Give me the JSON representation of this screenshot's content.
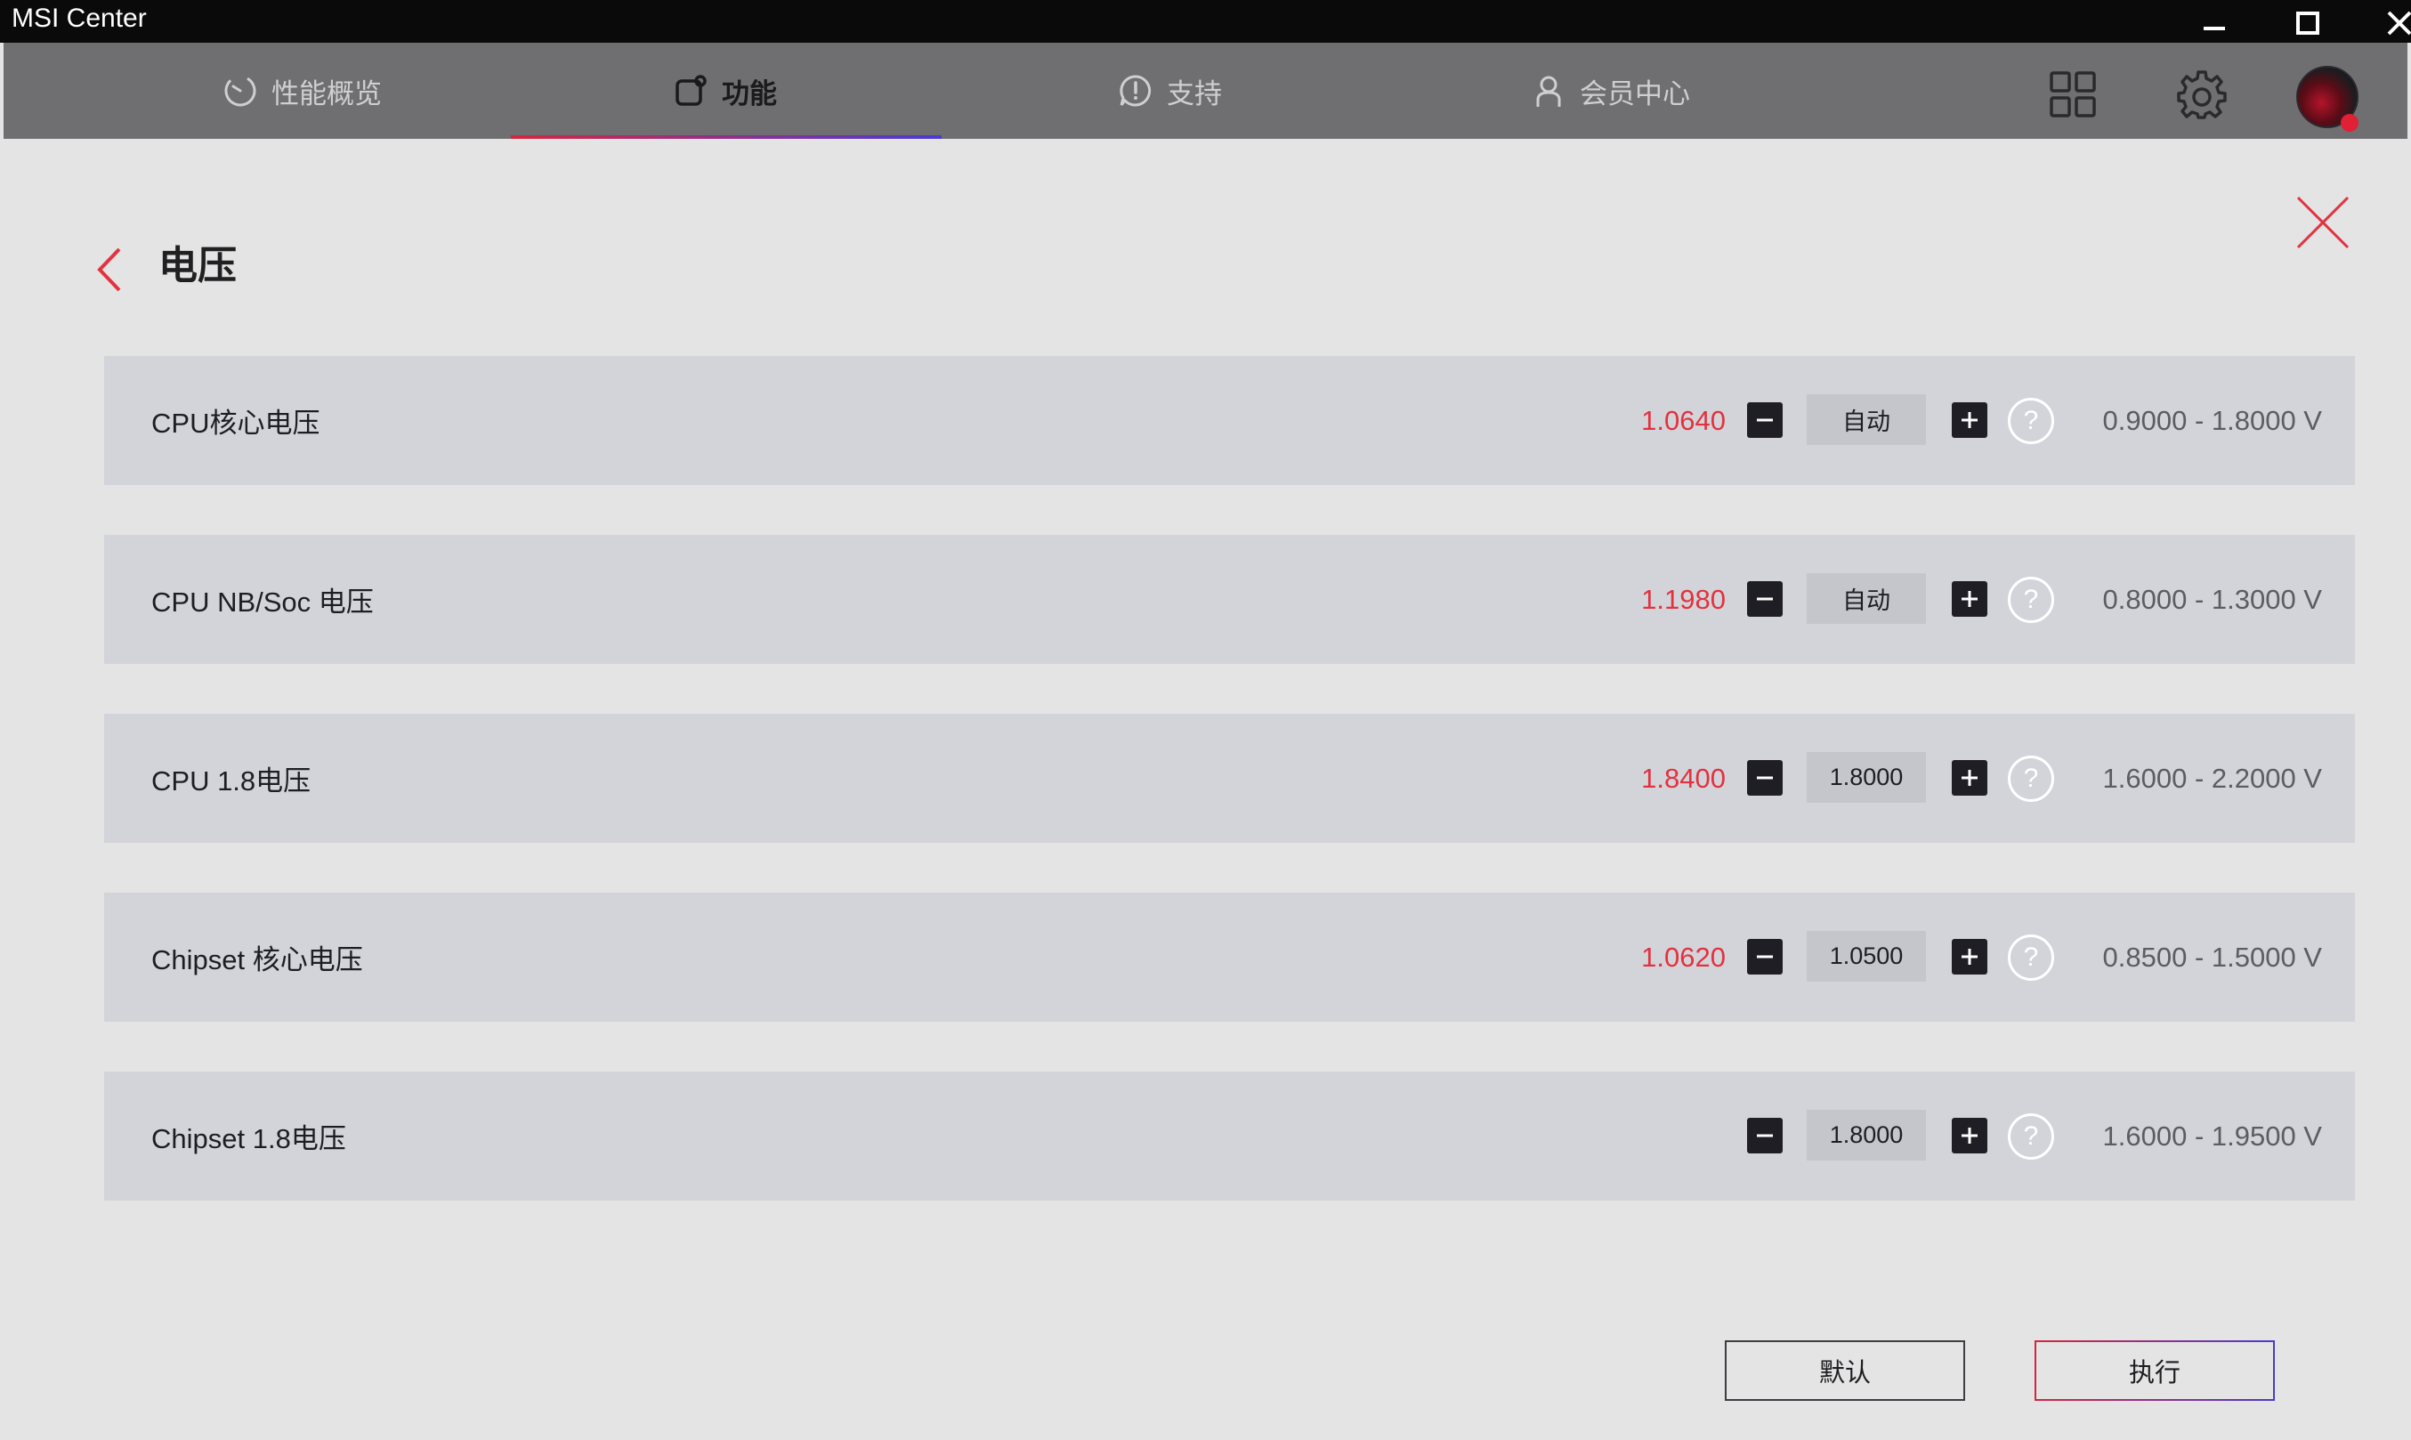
{
  "window": {
    "title": "MSI Center",
    "controls": {
      "minimize": "minimize-icon",
      "maximize": "maximize-icon",
      "close": "close-icon"
    }
  },
  "nav": {
    "tabs": [
      {
        "label": "性能概览",
        "icon": "performance-icon",
        "active": false
      },
      {
        "label": "功能",
        "icon": "features-icon",
        "active": true
      },
      {
        "label": "支持",
        "icon": "support-icon",
        "active": false
      },
      {
        "label": "会员中心",
        "icon": "member-icon",
        "active": false
      }
    ],
    "right_icons": [
      "apps-grid-icon",
      "gear-icon",
      "avatar"
    ]
  },
  "page": {
    "title": "电压",
    "back_icon": "chevron-left-icon",
    "close_icon": "close-x-icon"
  },
  "rows": [
    {
      "label": "CPU核心电压",
      "current": "1.0640",
      "value": "自动",
      "range": "0.9000 - 1.8000 V"
    },
    {
      "label": "CPU NB/Soc 电压",
      "current": "1.1980",
      "value": "自动",
      "range": "0.8000 - 1.3000 V"
    },
    {
      "label": "CPU 1.8电压",
      "current": "1.8400",
      "value": "1.8000",
      "range": "1.6000 - 2.2000 V"
    },
    {
      "label": "Chipset 核心电压",
      "current": "1.0620",
      "value": "1.0500",
      "range": "0.8500 - 1.5000 V"
    },
    {
      "label": "Chipset 1.8电压",
      "current": "",
      "value": "1.8000",
      "range": "1.6000 - 1.9500 V"
    }
  ],
  "help_glyph": "?",
  "buttons": {
    "default_label": "默认",
    "apply_label": "执行"
  },
  "colors": {
    "accent_red": "#e2323f",
    "nav_bg": "#6f6f72",
    "row_bg": "#d3d4d9",
    "page_bg": "#e4e4e4"
  }
}
